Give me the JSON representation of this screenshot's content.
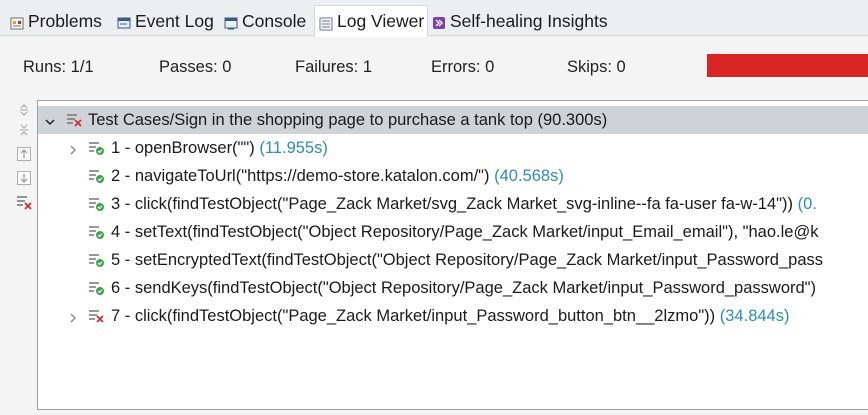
{
  "tabs": [
    {
      "label": "Problems",
      "icon": "problems-icon"
    },
    {
      "label": "Event Log",
      "icon": "event-log-icon"
    },
    {
      "label": "Console",
      "icon": "console-icon"
    },
    {
      "label": "Log Viewer",
      "icon": "log-viewer-icon"
    },
    {
      "label": "Self-healing Insights",
      "icon": "self-healing-icon"
    }
  ],
  "summary": {
    "runs": "Runs: 1/1",
    "passes": "Passes: 0",
    "failures": "Failures: 1",
    "errors": "Errors: 0",
    "skips": "Skips: 0",
    "progress_color": "#d92624"
  },
  "side_toolbar": [
    "expand-all-icon",
    "collapse-all-icon",
    "previous-icon",
    "next-icon",
    "show-failures-icon"
  ],
  "tree": {
    "root": {
      "label": "Test Cases/Sign in the shopping page to purchase a tank top",
      "duration": "(90.300s)",
      "status": "failed"
    },
    "steps": [
      {
        "label": "1 - openBrowser(\"\")",
        "duration": "(11.955s)",
        "status": "passed",
        "expandable": true
      },
      {
        "label": "2 - navigateToUrl(\"https://demo-store.katalon.com/\")",
        "duration": "(40.568s)",
        "status": "passed",
        "expandable": false
      },
      {
        "label": "3 - click(findTestObject(\"Page_Zack Market/svg_Zack Market_svg-inline--fa fa-user fa-w-14\"))",
        "duration": "(0.",
        "status": "passed",
        "expandable": false
      },
      {
        "label": "4 - setText(findTestObject(\"Object Repository/Page_Zack Market/input_Email_email\"), \"hao.le@k",
        "duration": "",
        "status": "passed",
        "expandable": false
      },
      {
        "label": "5 - setEncryptedText(findTestObject(\"Object Repository/Page_Zack Market/input_Password_pass",
        "duration": "",
        "status": "passed",
        "expandable": false
      },
      {
        "label": "6 - sendKeys(findTestObject(\"Object Repository/Page_Zack Market/input_Password_password\")",
        "duration": "",
        "status": "passed",
        "expandable": false
      },
      {
        "label": "7 - click(findTestObject(\"Page_Zack Market/input_Password_button_btn__2lzmo\"))",
        "duration": "(34.844s)",
        "status": "failed",
        "expandable": true
      }
    ]
  }
}
